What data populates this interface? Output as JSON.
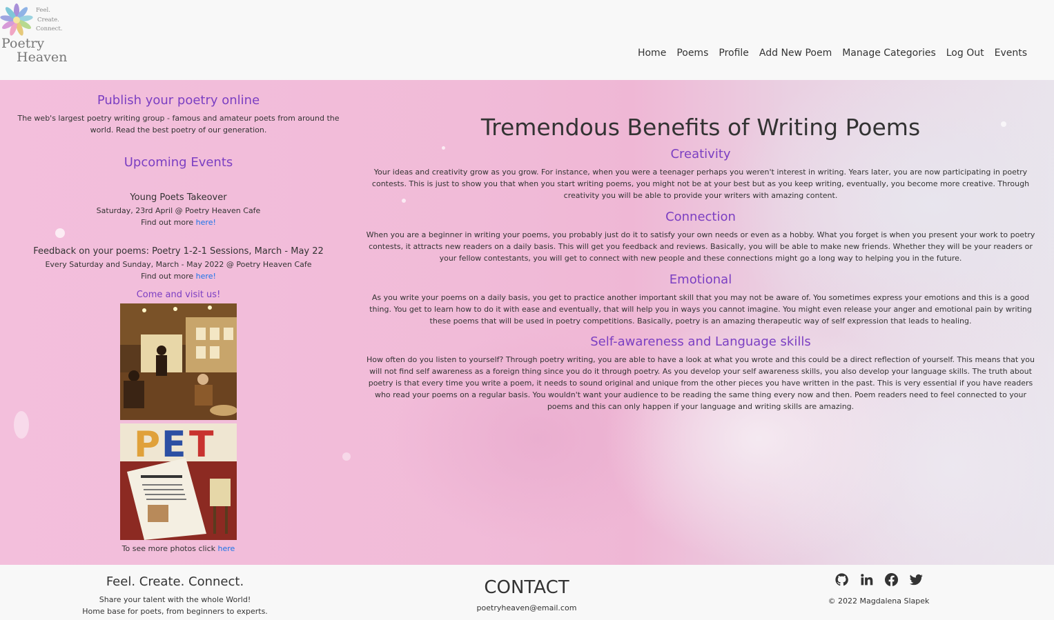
{
  "brand": {
    "tagline_lines": [
      "Feel.",
      "Create.",
      "Connect."
    ],
    "name_line1": "Poetry",
    "name_line2": "Heaven"
  },
  "nav": {
    "items": [
      "Home",
      "Poems",
      "Profile",
      "Add New Poem",
      "Manage Categories",
      "Log Out",
      "Events"
    ]
  },
  "sidebar": {
    "publish_title": "Publish your poetry online",
    "publish_text": "The web's largest poetry writing group - famous and amateur poets from around the world. Read the best poetry of our generation.",
    "events_title": "Upcoming Events",
    "events": [
      {
        "title": "Young Poets Takeover",
        "when": "Saturday, 23rd April @ Poetry Heaven Cafe",
        "more_prefix": "Find out more ",
        "more_link": "here!"
      },
      {
        "title": "Feedback on your poems: Poetry 1-2-1 Sessions, March - May 22",
        "when": "Every Saturday and Sunday, March - May 2022 @ Poetry Heaven Cafe",
        "more_prefix": "Find out more ",
        "more_link": "here!"
      }
    ],
    "visit_title": "Come and visit us!",
    "photos_prefix": "To see more photos click ",
    "photos_link": "here"
  },
  "main": {
    "title": "Tremendous Benefits of Writing Poems",
    "sections": [
      {
        "heading": "Creativity",
        "text": "Your ideas and creativity grow as you grow. For instance, when you were a teenager perhaps you weren't interest in writing. Years later, you are now participating in poetry contests. This is just to show you that when you start writing poems, you might not be at your best but as you keep writing, eventually, you become more creative. Through creativity you will be able to provide your writers with amazing content."
      },
      {
        "heading": "Connection",
        "text": "When you are a beginner in writing your poems, you probably just do it to satisfy your own needs or even as a hobby. What you forget is when you present your work to poetry contests, it attracts new readers on a daily basis. This will get you feedback and reviews. Basically, you will be able to make new friends. Whether they will be your readers or your fellow contestants, you will get to connect with new people and these connections might go a long way to helping you in the future."
      },
      {
        "heading": "Emotional",
        "text": "As you write your poems on a daily basis, you get to practice another important skill that you may not be aware of. You sometimes express your emotions and this is a good thing. You get to learn how to do it with ease and eventually, that will help you in ways you cannot imagine. You might even release your anger and emotional pain by writing these poems that will be used in poetry competitions. Basically, poetry is an amazing therapeutic way of self expression that leads to healing."
      },
      {
        "heading": "Self-awareness and Language skills",
        "text": "How often do you listen to yourself? Through poetry writing, you are able to have a look at what you wrote and this could be a direct reflection of yourself. This means that you will not find self awareness as a foreign thing since you do it through poetry. As you develop your self awareness skills, you also develop your language skills. The truth about poetry is that every time you write a poem, it needs to sound original and unique from the other pieces you have written in the past. This is very essential if you have readers who read your poems on a regular basis. You wouldn't want your audience to be reading the same thing every now and then. Poem readers need to feel connected to your poems and this can only happen if your language and writing skills are amazing."
      }
    ]
  },
  "footer": {
    "tagline": "Feel. Create. Connect.",
    "line1": "Share your talent with the whole World!",
    "line2": "Home base for poets, from beginners to experts.",
    "contact_title": "CONTACT",
    "email": "poetryheaven@email.com",
    "social_icons": [
      "github-icon",
      "linkedin-icon",
      "facebook-icon",
      "twitter-icon"
    ],
    "copyright": "© 2022 Magdalena Slapek"
  },
  "colors": {
    "accent": "#7b3fc2",
    "link": "#1a73e8",
    "text": "#333333",
    "hero_pink": "#f3bfdc"
  }
}
